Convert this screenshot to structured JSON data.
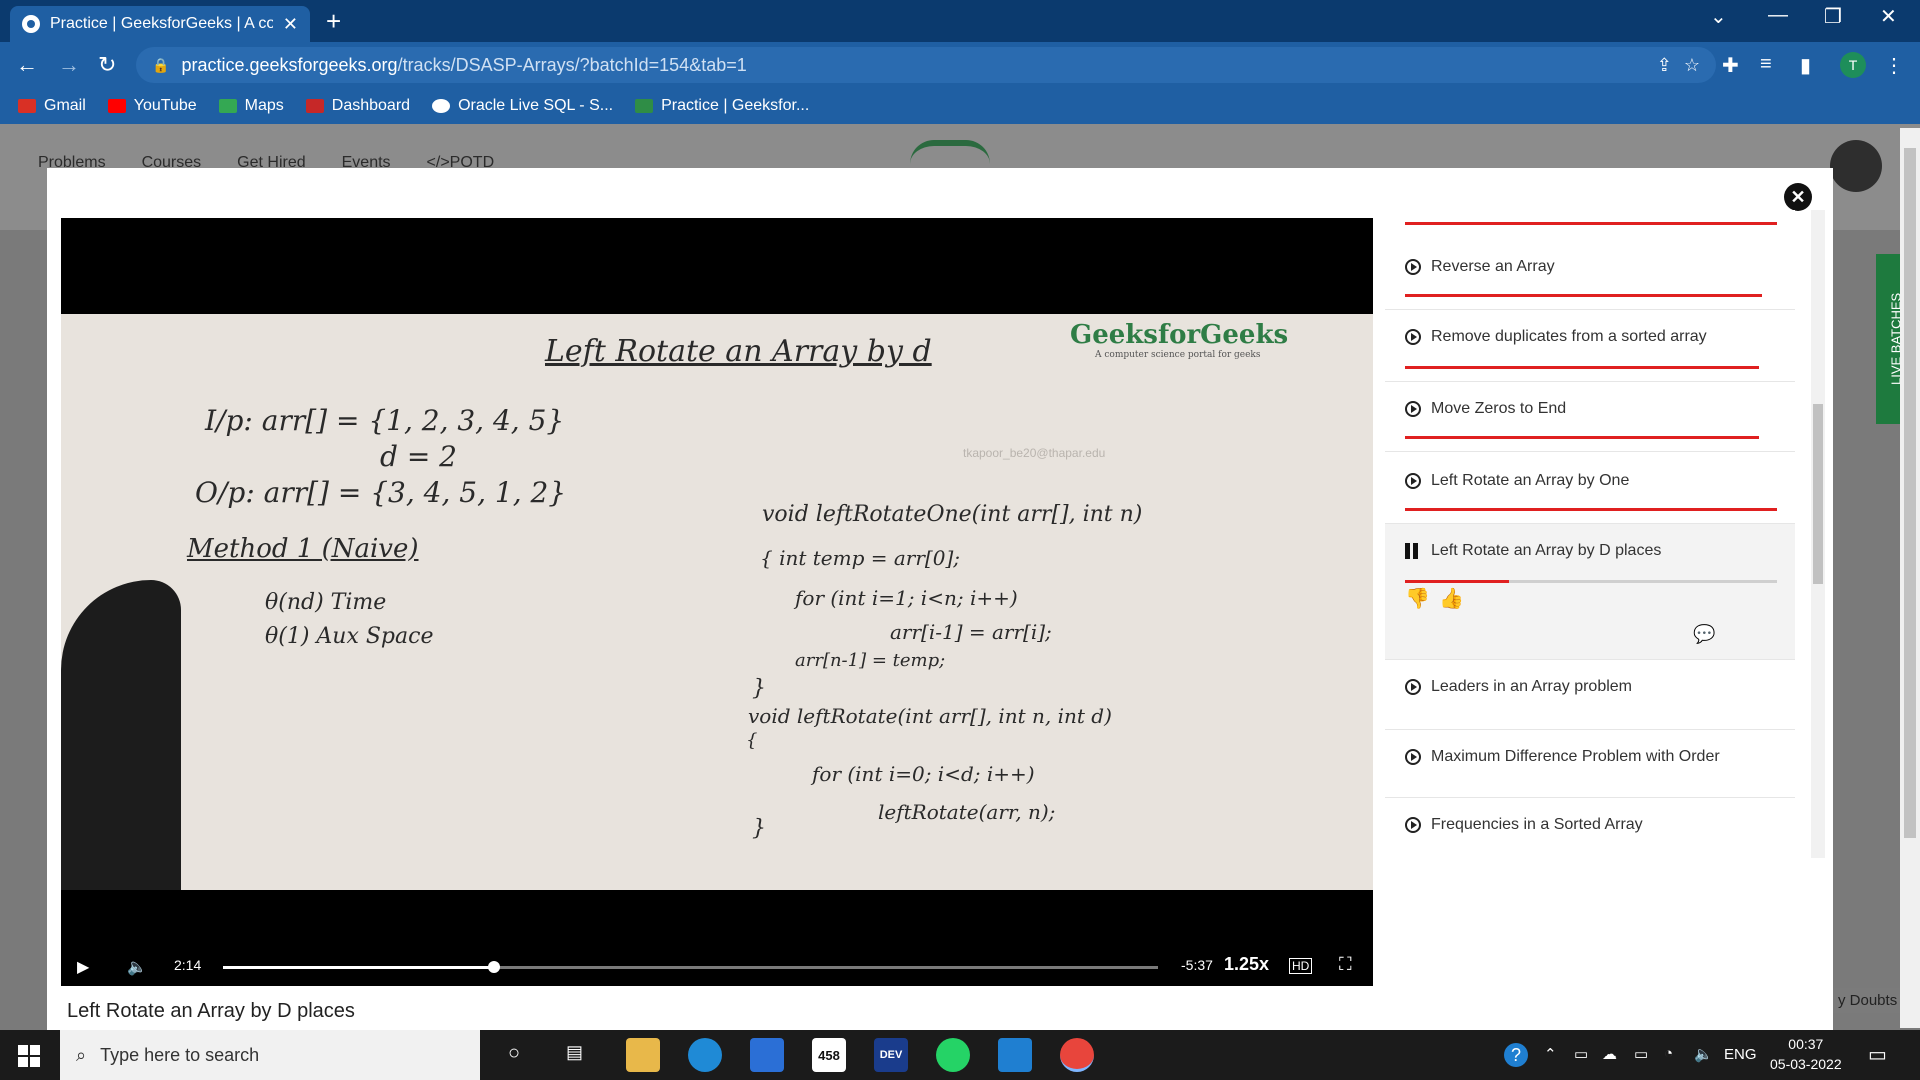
{
  "browser": {
    "tab_title": "Practice | GeeksforGeeks | A com",
    "url_host": "practice.geeksforgeeks.org",
    "url_path": "/tracks/DSASP-Arrays/?batchId=154&tab=1",
    "profile_initial": "T",
    "bookmarks": [
      {
        "label": "Gmail",
        "color": "#d93025"
      },
      {
        "label": "YouTube",
        "color": "#ff0000"
      },
      {
        "label": "Maps",
        "color": "#34a853"
      },
      {
        "label": "Dashboard",
        "color": "#c62828"
      },
      {
        "label": "Oracle Live SQL - S...",
        "color": "#ffffff"
      },
      {
        "label": "Practice | Geeksfor...",
        "color": "#2f8d46"
      }
    ]
  },
  "site": {
    "nav": [
      "Problems",
      "Courses",
      "Get Hired",
      "Events",
      "</>POTD"
    ],
    "live_batches": "LIVE BATCHES",
    "doubts": "y Doubts"
  },
  "video": {
    "slide": {
      "title": "Left Rotate an Array by d",
      "brand": "GeeksforGeeks",
      "brand_sub": "A computer science portal for geeks",
      "watermark": "tkapoor_be20@thapar.edu",
      "lines": [
        "I/p:    arr[] = {1, 2, 3, 4, 5}",
        "d = 2",
        "O/p:   arr[] = {3, 4, 5, 1, 2}",
        "Method 1 (Naive)",
        "θ(nd) Time",
        "θ(1) Aux Space",
        "void leftRotateOne(int arr[], int n)",
        "{  int temp = arr[0];",
        "for (int i=1; i<n; i++)",
        "arr[i-1] = arr[i];",
        "arr[n-1] = temp;",
        "}",
        "void leftRotate(int arr[], int n, int d)",
        "{",
        "for (int i=0; i<d; i++)",
        "leftRotate(arr, n);",
        "}"
      ]
    },
    "elapsed": "2:14",
    "remaining": "-5:37",
    "speed": "1.25x",
    "progress": 0.29,
    "title": "Left Rotate an Array by D places"
  },
  "playlist": [
    {
      "label": "Reverse an Array",
      "progress": 0.96
    },
    {
      "label": "Remove duplicates from a sorted array",
      "progress": 0.95
    },
    {
      "label": "Move Zeros to End",
      "progress": 0.95
    },
    {
      "label": "Left Rotate an Array by One",
      "progress": 1.0
    },
    {
      "label": "Left Rotate an Array by D places",
      "progress": 0.28,
      "active": true
    },
    {
      "label": "Leaders in an Array problem"
    },
    {
      "label": "Maximum Difference Problem with Order"
    },
    {
      "label": "Frequencies in a Sorted Array"
    }
  ],
  "taskbar": {
    "search_placeholder": "Type here to search",
    "badge": "458",
    "dev_label": "DEV",
    "lang": "ENG",
    "time": "00:37",
    "date": "05-03-2022"
  }
}
